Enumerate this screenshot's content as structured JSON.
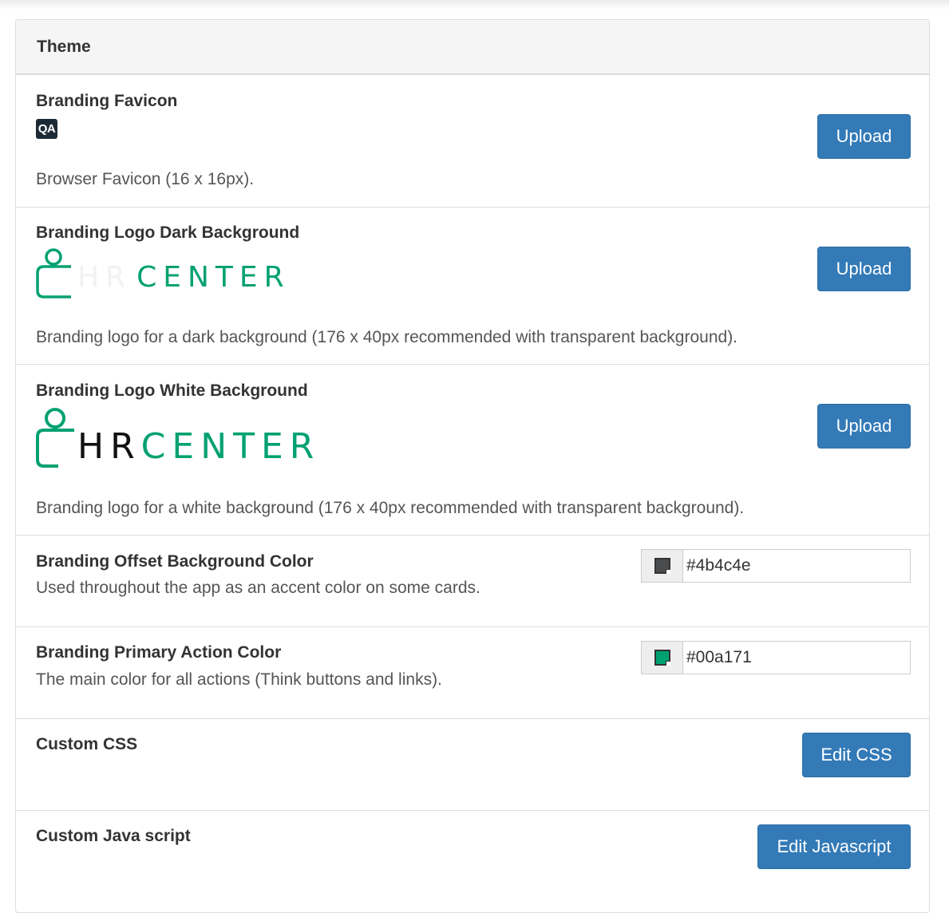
{
  "panel": {
    "title": "Theme"
  },
  "favicon": {
    "title": "Branding Favicon",
    "preview_text": "QA",
    "description": "Browser Favicon (16 x 16px).",
    "button_label": "Upload"
  },
  "logo_dark": {
    "title": "Branding Logo Dark Background",
    "logo_prefix": "HR",
    "logo_word": "CENTER",
    "description": "Branding logo for a dark background (176 x 40px recommended with transparent background).",
    "button_label": "Upload"
  },
  "logo_white": {
    "title": "Branding Logo White Background",
    "logo_prefix": "HR",
    "logo_word": "CENTER",
    "description": "Branding logo for a white background (176 x 40px recommended with transparent background).",
    "button_label": "Upload"
  },
  "offset_color": {
    "title": "Branding Offset Background Color",
    "description": "Used throughout the app as an accent color on some cards.",
    "value": "#4b4c4e"
  },
  "primary_color": {
    "title": "Branding Primary Action Color",
    "description": "The main color for all actions (Think buttons and links).",
    "value": "#00a171"
  },
  "custom_css": {
    "title": "Custom CSS",
    "button_label": "Edit CSS"
  },
  "custom_js": {
    "title": "Custom Java script",
    "button_label": "Edit Javascript"
  },
  "colors": {
    "brand_green": "#00a171",
    "button_blue": "#337ab7"
  }
}
